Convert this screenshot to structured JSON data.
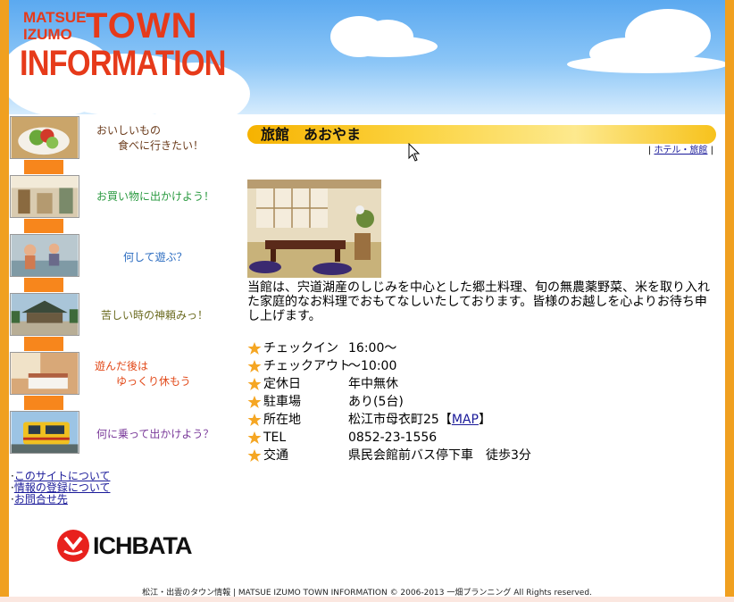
{
  "header": {
    "logo": {
      "line1": "MATSUE",
      "line2": "IZUMO",
      "word1": "TOWN",
      "word2": "INFORMATION"
    }
  },
  "nav": {
    "items": [
      {
        "label": "おいしいもの\n　　食べに行きたい！",
        "color": "#6a3a1a",
        "icon": "food-photo"
      },
      {
        "label": "お買い物に出かけよう！",
        "color": "#2a9a40",
        "icon": "shopping-photo"
      },
      {
        "label": "何して遊ぶ？",
        "color": "#2a6bc0",
        "icon": "play-photo"
      },
      {
        "label": "苦しい時の神頼みっ！",
        "color": "#6b6b20",
        "icon": "shrine-photo"
      },
      {
        "label": "遊んだ後は\n　　ゆっくり休もう",
        "color": "#e24a1a",
        "icon": "hotel-room-photo"
      },
      {
        "label": "何に乗って出かけよう？",
        "color": "#7a3a9a",
        "icon": "train-photo"
      }
    ]
  },
  "links": [
    {
      "label": "このサイトについて"
    },
    {
      "label": "情報の登録について"
    },
    {
      "label": "お問合せ先"
    }
  ],
  "sponsor": {
    "name": "ICHBATA"
  },
  "footer": {
    "text": "松江・出雲のタウン情報 | MATSUE IZUMO TOWN INFORMATION © 2006-2013 一畑プランニング All Rights reserved."
  },
  "page": {
    "title": "旅館　あおやま",
    "breadcrumb": {
      "prefix": "|",
      "link": "ホテル・旅館",
      "suffix": "|"
    },
    "description": "当館は、宍道湖産のしじみを中心とした郷土料理、旬の無農薬野菜、米を取り入れた家庭的なお料理でおもてなしいたしております。皆様のお越しを心よりお待ち申し上げます。",
    "info": [
      {
        "label": "チェックイン",
        "value": "16:00～"
      },
      {
        "label": "チェックアウト",
        "value": "～10:00"
      },
      {
        "label": "定休日",
        "value": "年中無休"
      },
      {
        "label": "駐車場",
        "value": "あり(5台)"
      },
      {
        "label": "所在地",
        "value": "松江市母衣町25",
        "link_open": "【",
        "link": "MAP",
        "link_close": "】"
      },
      {
        "label": "TEL",
        "value": "0852-23-1556"
      },
      {
        "label": "交通",
        "value": "県民会館前バス停下車　徒歩3分"
      }
    ]
  },
  "colors": {
    "accent": "#f0a020",
    "logo": "#e63a1a",
    "nav_bar": "#f7861c",
    "star": "#f5a623",
    "link": "#1a1a99"
  }
}
